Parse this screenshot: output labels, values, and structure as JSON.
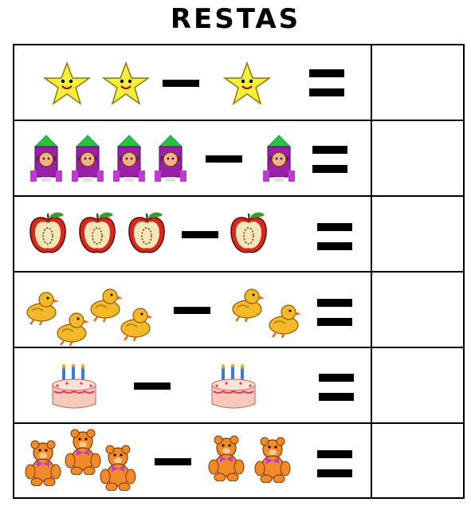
{
  "page": {
    "title": "RESTAS"
  },
  "exercises": [
    {
      "operation": "subtraction",
      "item": "star-icon",
      "minuend": 2,
      "subtrahend": 1
    },
    {
      "operation": "subtraction",
      "item": "rocket-icon",
      "minuend": 4,
      "subtrahend": 1
    },
    {
      "operation": "subtraction",
      "item": "apple-icon",
      "minuend": 3,
      "subtrahend": 1
    },
    {
      "operation": "subtraction",
      "item": "duck-icon",
      "minuend": 4,
      "subtrahend": 2
    },
    {
      "operation": "subtraction",
      "item": "cake-icon",
      "minuend": 1,
      "subtrahend": 1
    },
    {
      "operation": "subtraction",
      "item": "teddy-bear-icon",
      "minuend": 3,
      "subtrahend": 2
    }
  ],
  "colors": {
    "star": "#f5ee3c",
    "rocket": "#9b1fa8",
    "apple": "#d22a1e",
    "duck": "#f3b92b",
    "cake": "#f7c9b9",
    "bear": "#f08a2a"
  }
}
